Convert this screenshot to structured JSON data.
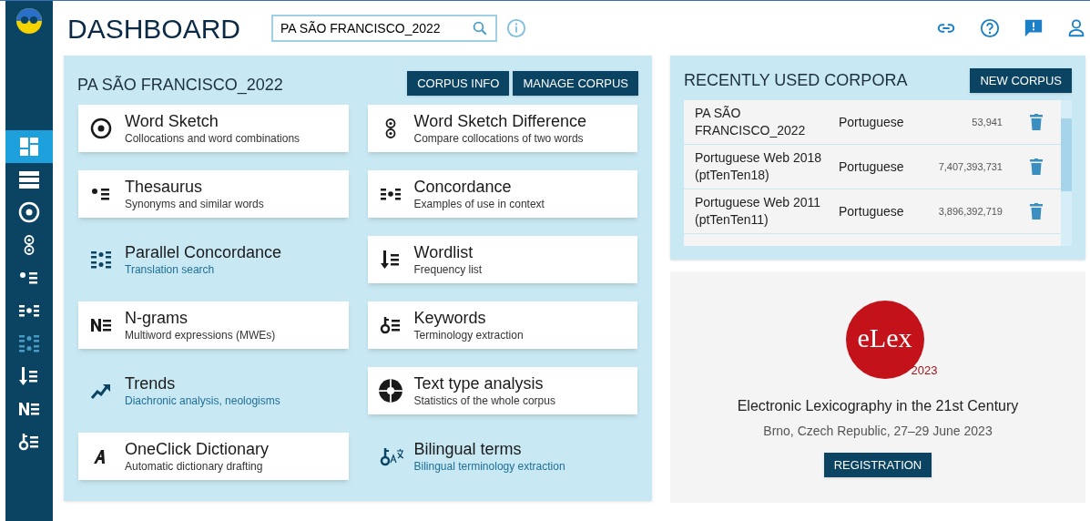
{
  "header": {
    "title": "DASHBOARD",
    "search": {
      "value": "PA SÃO FRANCISCO_2022"
    }
  },
  "sidebar": {
    "items": [
      {
        "selected": true,
        "disabled": false
      },
      {
        "selected": false,
        "disabled": false
      },
      {
        "selected": false,
        "disabled": false
      },
      {
        "selected": false,
        "disabled": false
      },
      {
        "selected": false,
        "disabled": false
      },
      {
        "selected": false,
        "disabled": false
      },
      {
        "selected": false,
        "disabled": true
      },
      {
        "selected": false,
        "disabled": false
      },
      {
        "selected": false,
        "disabled": false
      },
      {
        "selected": false,
        "disabled": false
      }
    ]
  },
  "corpus_panel": {
    "title": "PA SÃO FRANCISCO_2022",
    "buttons": [
      "CORPUS INFO",
      "MANAGE CORPUS"
    ],
    "tools": [
      {
        "kind": "card",
        "title": "Word Sketch",
        "subtitle": "Collocations and word combinations"
      },
      {
        "kind": "card",
        "title": "Word Sketch Difference",
        "subtitle": "Compare collocations of two words"
      },
      {
        "kind": "card",
        "title": "Thesaurus",
        "subtitle": "Synonyms and similar words"
      },
      {
        "kind": "card",
        "title": "Concordance",
        "subtitle": "Examples of use in context"
      },
      {
        "kind": "flat",
        "title": "Parallel Concordance",
        "subtitle": "Translation search"
      },
      {
        "kind": "card",
        "title": "Wordlist",
        "subtitle": "Frequency list"
      },
      {
        "kind": "card",
        "title": "N-grams",
        "subtitle": "Multiword expressions (MWEs)"
      },
      {
        "kind": "card",
        "title": "Keywords",
        "subtitle": "Terminology extraction"
      },
      {
        "kind": "flat",
        "title": "Trends",
        "subtitle": "Diachronic analysis, neologisms"
      },
      {
        "kind": "card",
        "title": "Text type analysis",
        "subtitle": "Statistics of the whole corpus"
      },
      {
        "kind": "card",
        "title": "OneClick Dictionary",
        "subtitle": "Automatic dictionary drafting"
      },
      {
        "kind": "flat",
        "title": "Bilingual terms",
        "subtitle": "Bilingual terminology extraction"
      }
    ]
  },
  "recent_panel": {
    "title": "RECENTLY USED CORPORA",
    "button": "NEW CORPUS",
    "rows": [
      {
        "name": "PA SÃO FRANCISCO_2022",
        "language": "Portuguese",
        "size": "53,941"
      },
      {
        "name": "Portuguese Web 2018 (ptTenTen18)",
        "language": "Portuguese",
        "size": "7,407,393,731"
      },
      {
        "name": "Portuguese Web 2011 (ptTenTen11)",
        "language": "Portuguese",
        "size": "3,896,392,719"
      }
    ]
  },
  "promo": {
    "logo_text": "eLex",
    "logo_year": "2023",
    "title": "Electronic Lexicography in the 21st Century",
    "subtitle": "Brno, Czech Republic, 27–29 June 2023",
    "button": "REGISTRATION"
  }
}
